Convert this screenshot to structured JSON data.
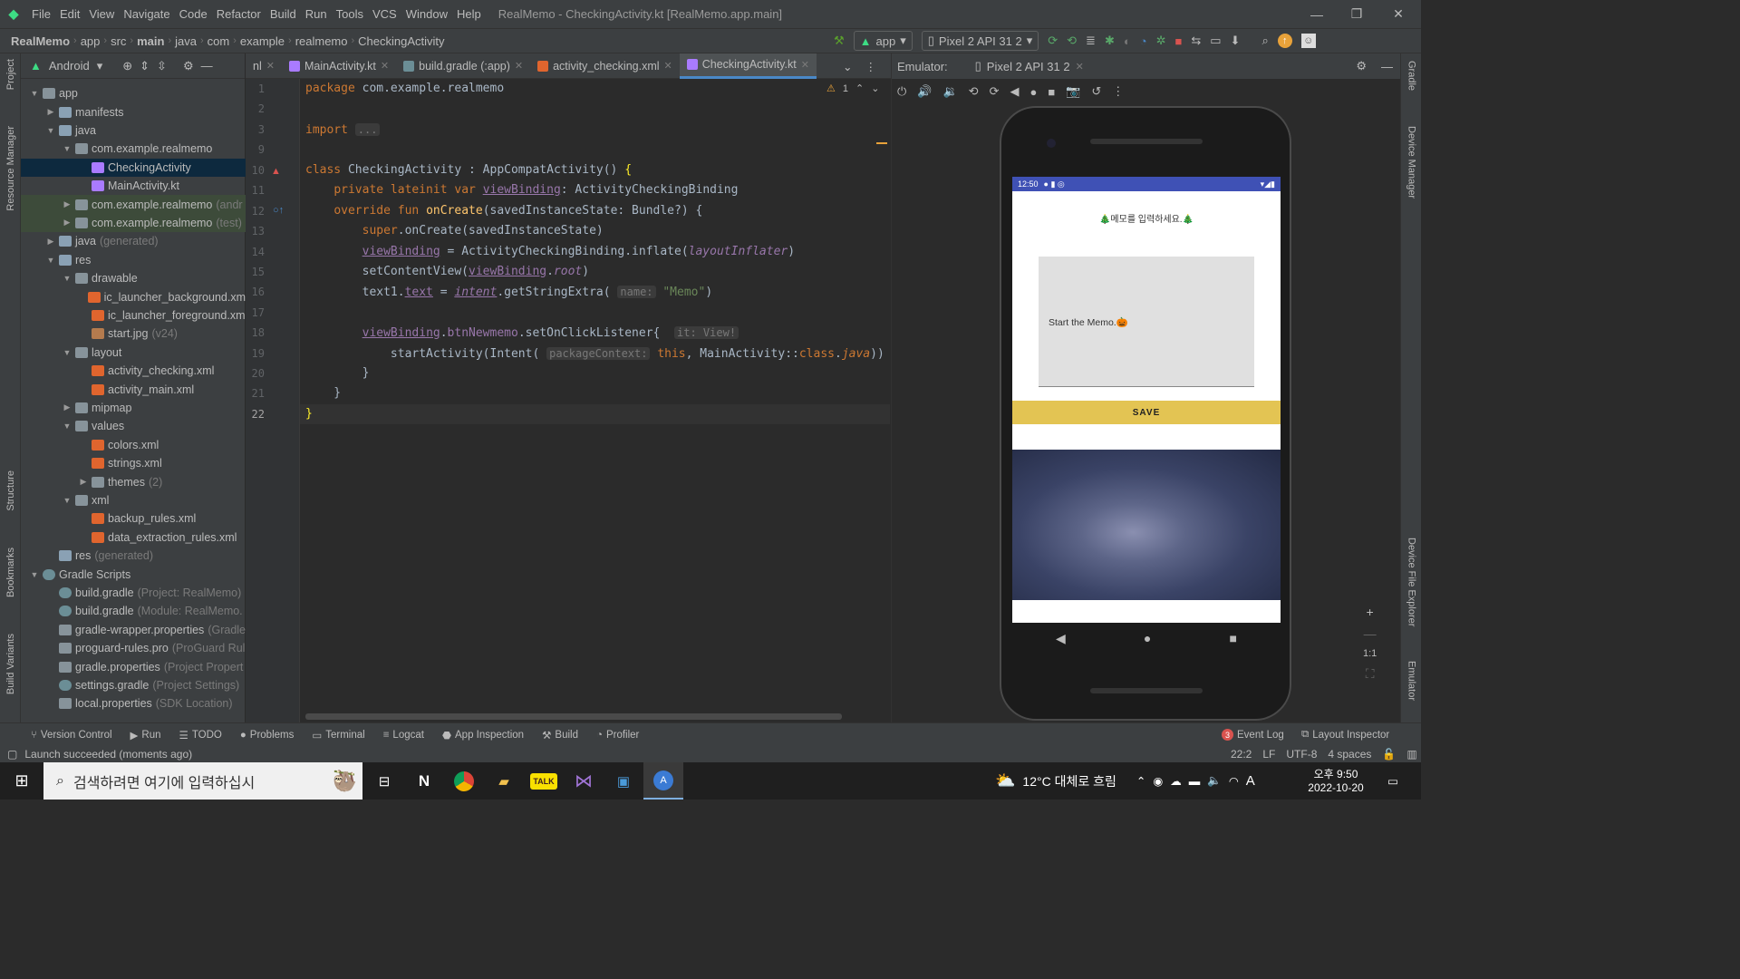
{
  "menubar": {
    "items": [
      "File",
      "Edit",
      "View",
      "Navigate",
      "Code",
      "Refactor",
      "Build",
      "Run",
      "Tools",
      "VCS",
      "Window",
      "Help"
    ],
    "title": "RealMemo - CheckingActivity.kt [RealMemo.app.main]"
  },
  "navbar": {
    "breadcrumbs": [
      "RealMemo",
      "app",
      "src",
      "main",
      "java",
      "com",
      "example",
      "realmemo",
      "CheckingActivity"
    ],
    "run_config": "app",
    "device": "Pixel 2 API 31 2"
  },
  "project": {
    "view_label": "Android",
    "tree": [
      {
        "depth": 0,
        "label": "app",
        "hint": "",
        "icon": "foldb",
        "chev": "open",
        "state": ""
      },
      {
        "depth": 1,
        "label": "manifests",
        "hint": "",
        "icon": "fold",
        "chev": "closed",
        "state": ""
      },
      {
        "depth": 1,
        "label": "java",
        "hint": "",
        "icon": "fold",
        "chev": "open",
        "state": ""
      },
      {
        "depth": 2,
        "label": "com.example.realmemo",
        "hint": "",
        "icon": "foldb",
        "chev": "open",
        "state": ""
      },
      {
        "depth": 3,
        "label": "CheckingActivity",
        "hint": "",
        "icon": "kt",
        "chev": "",
        "state": "sel"
      },
      {
        "depth": 3,
        "label": "MainActivity.kt",
        "hint": "",
        "icon": "kt",
        "chev": "",
        "state": ""
      },
      {
        "depth": 2,
        "label": "com.example.realmemo",
        "hint": "(andr",
        "icon": "foldb",
        "chev": "closed",
        "state": "hl"
      },
      {
        "depth": 2,
        "label": "com.example.realmemo",
        "hint": "(test)",
        "icon": "foldb",
        "chev": "closed",
        "state": "hl"
      },
      {
        "depth": 1,
        "label": "java",
        "hint": "(generated)",
        "icon": "fold",
        "chev": "closed",
        "state": ""
      },
      {
        "depth": 1,
        "label": "res",
        "hint": "",
        "icon": "fold",
        "chev": "open",
        "state": ""
      },
      {
        "depth": 2,
        "label": "drawable",
        "hint": "",
        "icon": "foldb",
        "chev": "open",
        "state": ""
      },
      {
        "depth": 3,
        "label": "ic_launcher_background.xm",
        "hint": "",
        "icon": "xml",
        "chev": "",
        "state": ""
      },
      {
        "depth": 3,
        "label": "ic_launcher_foreground.xm",
        "hint": "",
        "icon": "xml",
        "chev": "",
        "state": ""
      },
      {
        "depth": 3,
        "label": "start.jpg",
        "hint": "(v24)",
        "icon": "img",
        "chev": "",
        "state": ""
      },
      {
        "depth": 2,
        "label": "layout",
        "hint": "",
        "icon": "foldb",
        "chev": "open",
        "state": ""
      },
      {
        "depth": 3,
        "label": "activity_checking.xml",
        "hint": "",
        "icon": "xml",
        "chev": "",
        "state": ""
      },
      {
        "depth": 3,
        "label": "activity_main.xml",
        "hint": "",
        "icon": "xml",
        "chev": "",
        "state": ""
      },
      {
        "depth": 2,
        "label": "mipmap",
        "hint": "",
        "icon": "foldb",
        "chev": "closed",
        "state": ""
      },
      {
        "depth": 2,
        "label": "values",
        "hint": "",
        "icon": "foldb",
        "chev": "open",
        "state": ""
      },
      {
        "depth": 3,
        "label": "colors.xml",
        "hint": "",
        "icon": "xml",
        "chev": "",
        "state": ""
      },
      {
        "depth": 3,
        "label": "strings.xml",
        "hint": "",
        "icon": "xml",
        "chev": "",
        "state": ""
      },
      {
        "depth": 3,
        "label": "themes",
        "hint": "(2)",
        "icon": "foldb",
        "chev": "closed",
        "state": ""
      },
      {
        "depth": 2,
        "label": "xml",
        "hint": "",
        "icon": "foldb",
        "chev": "open",
        "state": ""
      },
      {
        "depth": 3,
        "label": "backup_rules.xml",
        "hint": "",
        "icon": "xml",
        "chev": "",
        "state": ""
      },
      {
        "depth": 3,
        "label": "data_extraction_rules.xml",
        "hint": "",
        "icon": "xml",
        "chev": "",
        "state": ""
      },
      {
        "depth": 1,
        "label": "res",
        "hint": "(generated)",
        "icon": "fold",
        "chev": "",
        "state": ""
      },
      {
        "depth": 0,
        "label": "Gradle Scripts",
        "hint": "",
        "icon": "gr",
        "chev": "open",
        "state": ""
      },
      {
        "depth": 1,
        "label": "build.gradle",
        "hint": "(Project: RealMemo)",
        "icon": "gr",
        "chev": "",
        "state": ""
      },
      {
        "depth": 1,
        "label": "build.gradle",
        "hint": "(Module: RealMemo.",
        "icon": "gr",
        "chev": "",
        "state": ""
      },
      {
        "depth": 1,
        "label": "gradle-wrapper.properties",
        "hint": "(Gradle",
        "icon": "foldb",
        "chev": "",
        "state": ""
      },
      {
        "depth": 1,
        "label": "proguard-rules.pro",
        "hint": "(ProGuard Rul",
        "icon": "foldb",
        "chev": "",
        "state": ""
      },
      {
        "depth": 1,
        "label": "gradle.properties",
        "hint": "(Project Propert",
        "icon": "foldb",
        "chev": "",
        "state": ""
      },
      {
        "depth": 1,
        "label": "settings.gradle",
        "hint": "(Project Settings)",
        "icon": "gr",
        "chev": "",
        "state": ""
      },
      {
        "depth": 1,
        "label": "local.properties",
        "hint": "(SDK Location)",
        "icon": "foldb",
        "chev": "",
        "state": ""
      }
    ]
  },
  "editor": {
    "tabs": [
      {
        "label": "nl",
        "icon": "",
        "active": false
      },
      {
        "label": "MainActivity.kt",
        "icon": "kt",
        "active": false
      },
      {
        "label": "build.gradle (:app)",
        "icon": "gr",
        "active": false
      },
      {
        "label": "activity_checking.xml",
        "icon": "xml",
        "active": false
      },
      {
        "label": "CheckingActivity.kt",
        "icon": "kt",
        "active": true
      }
    ],
    "warning_count": "1",
    "line_numbers": [
      "1",
      "2",
      "3",
      "9",
      "10",
      "11",
      "12",
      "13",
      "14",
      "15",
      "16",
      "17",
      "18",
      "19",
      "20",
      "21",
      "22"
    ],
    "current_line": "22"
  },
  "emulator": {
    "label": "Emulator:",
    "device_tab": "Pixel 2 API 31 2",
    "zoom_label": "1:1"
  },
  "app": {
    "time": "12:50",
    "title": "🎄메모를 입력하세요.🎄",
    "memo_text": "Start the Memo.🎃",
    "save_label": "SAVE"
  },
  "bottom_tabs": [
    "Version Control",
    "Run",
    "TODO",
    "Problems",
    "Terminal",
    "Logcat",
    "App Inspection",
    "Build",
    "Profiler"
  ],
  "event_log": {
    "count": "3",
    "label": "Event Log"
  },
  "layout_inspector": "Layout Inspector",
  "status": {
    "message": "Launch succeeded (moments ago)",
    "position": "22:2",
    "line_sep": "LF",
    "encoding": "UTF-8",
    "indent": "4 spaces"
  },
  "side_tools": {
    "left": [
      "Project",
      "Resource Manager",
      "Structure",
      "Bookmarks",
      "Build Variants"
    ],
    "right": [
      "Gradle",
      "Device Manager",
      "Device File Explorer",
      "Emulator"
    ]
  },
  "taskbar": {
    "search_placeholder": "검색하려면 여기에 입력하십시",
    "weather": "12°C 대체로 흐림",
    "ime": "A",
    "time": "오후 9:50",
    "date": "2022-10-20"
  },
  "colors": {
    "accent": "#4a88c7",
    "android": "#3ddc84",
    "save": "#e3c453",
    "status": "#3f51b5"
  }
}
